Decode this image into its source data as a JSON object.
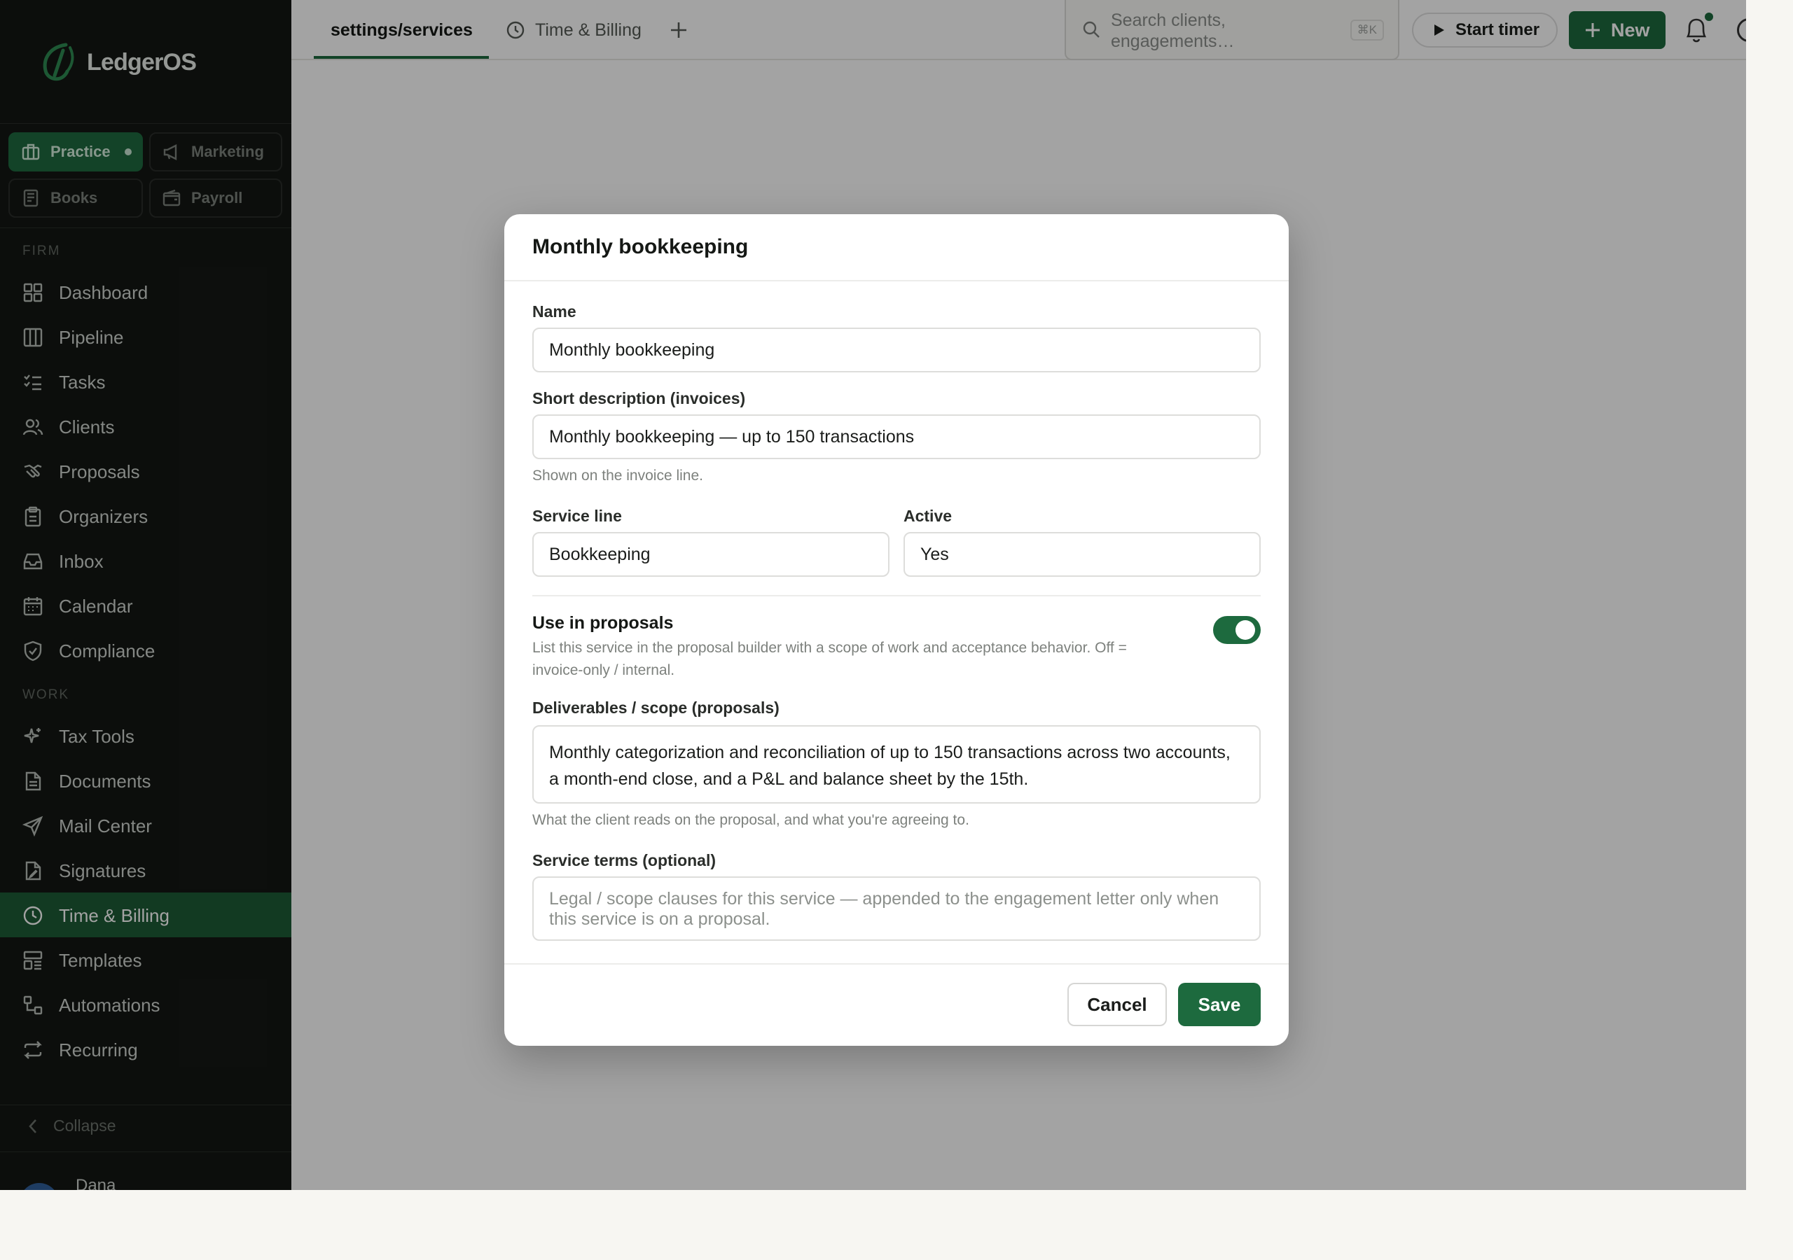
{
  "app": {
    "brand": "LedgerOS"
  },
  "sidebar": {
    "modules": [
      {
        "label": "Practice",
        "icon": "briefcase-icon",
        "active": true
      },
      {
        "label": "Marketing",
        "icon": "megaphone-icon"
      },
      {
        "label": "Books",
        "icon": "book-icon"
      },
      {
        "label": "Payroll",
        "icon": "wallet-icon"
      }
    ],
    "sections": [
      {
        "title": "FIRM",
        "items": [
          {
            "label": "Dashboard",
            "icon": "grid-icon"
          },
          {
            "label": "Pipeline",
            "icon": "columns-icon"
          },
          {
            "label": "Tasks",
            "icon": "checklist-icon"
          },
          {
            "label": "Clients",
            "icon": "users-icon"
          },
          {
            "label": "Proposals",
            "icon": "handshake-icon"
          },
          {
            "label": "Organizers",
            "icon": "clipboard-icon"
          },
          {
            "label": "Inbox",
            "icon": "inbox-icon"
          },
          {
            "label": "Calendar",
            "icon": "calendar-icon"
          },
          {
            "label": "Compliance",
            "icon": "shield-check-icon"
          }
        ]
      },
      {
        "title": "WORK",
        "items": [
          {
            "label": "Tax Tools",
            "icon": "sparkle-icon"
          },
          {
            "label": "Documents",
            "icon": "document-icon"
          },
          {
            "label": "Mail Center",
            "icon": "send-icon"
          },
          {
            "label": "Signatures",
            "icon": "signature-icon"
          },
          {
            "label": "Time & Billing",
            "icon": "clock-icon",
            "active": true
          },
          {
            "label": "Templates",
            "icon": "layout-icon"
          },
          {
            "label": "Automations",
            "icon": "workflow-icon"
          },
          {
            "label": "Recurring",
            "icon": "repeat-icon"
          }
        ]
      }
    ],
    "collapse_label": "Collapse",
    "user_name": "Dana"
  },
  "topbar": {
    "tabs": [
      {
        "label": "settings/services",
        "active": true
      },
      {
        "label": "Time & Billing",
        "icon": "clock-icon"
      }
    ],
    "search_placeholder": "Search clients, engagements…",
    "search_shortcut": "⌘K",
    "start_timer_label": "Start timer",
    "new_label": "New"
  },
  "modal": {
    "title": "Monthly bookkeeping",
    "name_label": "Name",
    "name_value": "Monthly bookkeeping",
    "short_desc_label": "Short description (invoices)",
    "short_desc_value": "Monthly bookkeeping — up to 150 transactions",
    "short_desc_hint": "Shown on the invoice line.",
    "service_line_label": "Service line",
    "service_line_value": "Bookkeeping",
    "active_label": "Active",
    "active_value": "Yes",
    "use_in_proposals_label": "Use in proposals",
    "use_in_proposals_desc": "List this service in the proposal builder with a scope of work and acceptance behavior. Off = invoice-only / internal.",
    "use_in_proposals_on": true,
    "deliverables_label": "Deliverables / scope (proposals)",
    "deliverables_value": "Monthly categorization and reconciliation of up to 150 transactions across two accounts, a month-end close, and a P&L and balance sheet by the 15th.",
    "deliverables_hint": "What the client reads on the proposal, and what you're agreeing to.",
    "terms_label": "Service terms (optional)",
    "terms_placeholder": "Legal / scope clauses for this service — appended to the engagement letter only when this service is on a proposal.",
    "cancel_label": "Cancel",
    "save_label": "Save"
  },
  "colors": {
    "brand_green": "#1d6a3e",
    "sidebar_bg": "#141714",
    "active_nav_bg": "#1d5b36"
  }
}
